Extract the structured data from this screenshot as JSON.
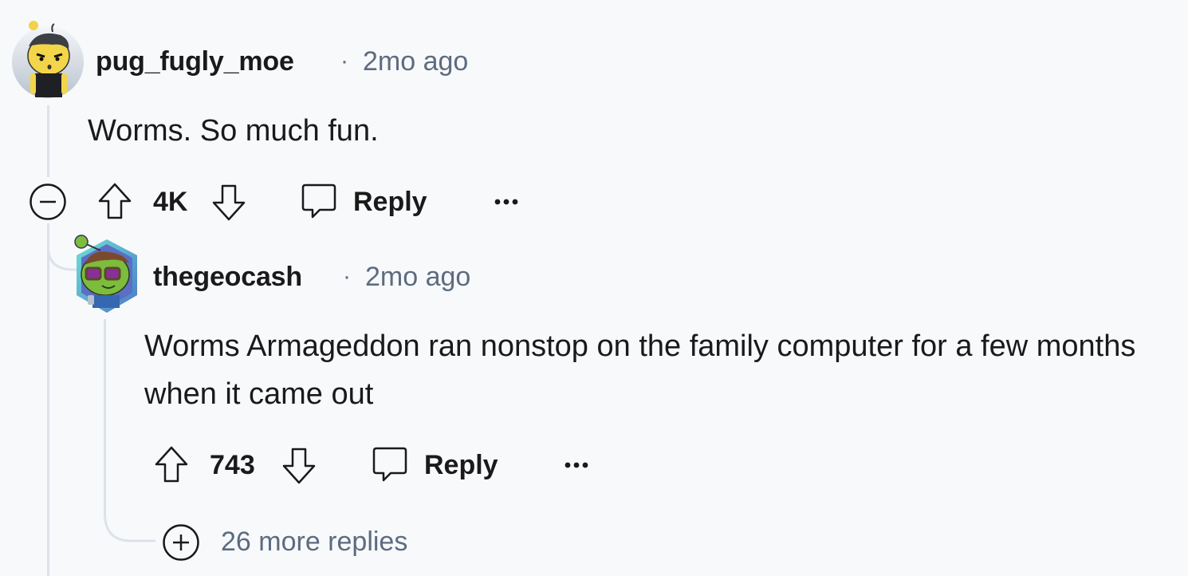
{
  "comments": [
    {
      "username": "pug_fugly_moe",
      "separator": "·",
      "time": "2mo ago",
      "body": "Worms. So much fun.",
      "votes": "4K",
      "reply_label": "Reply",
      "more_label": "···",
      "avatar": "yellow-snoo-avatar"
    },
    {
      "username": "thegeocash",
      "separator": "·",
      "time": "2mo ago",
      "body": "Worms Armageddon ran nonstop on the family computer for a few months when it came out",
      "votes": "743",
      "reply_label": "Reply",
      "more_label": "···",
      "avatar": "green-snoo-hex-avatar"
    }
  ],
  "more_replies": "26 more replies",
  "colors": {
    "background": "#f8f9fb",
    "thread_line": "#dde2ea",
    "meta_text": "#5c6c80",
    "primary_text": "#1a1a1b"
  }
}
